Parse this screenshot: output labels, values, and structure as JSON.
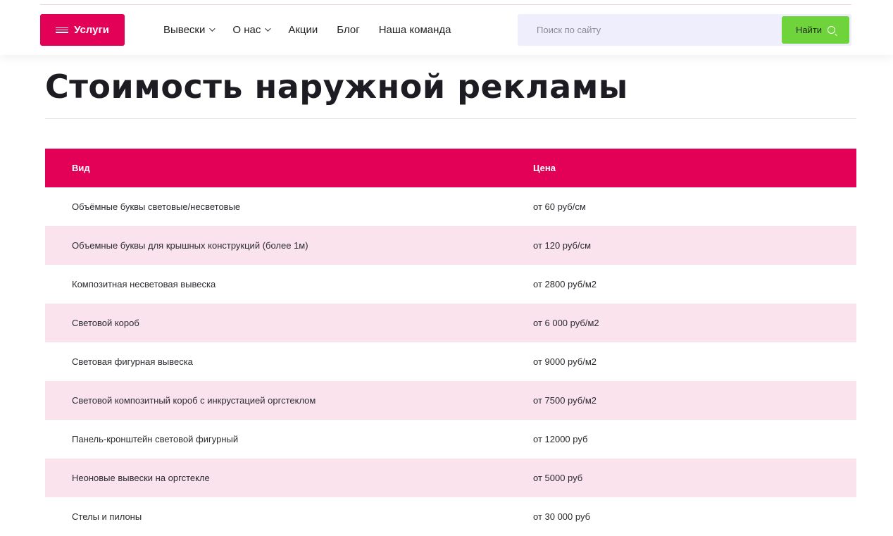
{
  "header": {
    "services_label": "Услуги",
    "nav": [
      {
        "label": "Вывески",
        "has_dropdown": true
      },
      {
        "label": "О нас",
        "has_dropdown": true
      },
      {
        "label": "Акции",
        "has_dropdown": false
      },
      {
        "label": "Блог",
        "has_dropdown": false
      },
      {
        "label": "Наша команда",
        "has_dropdown": false
      }
    ],
    "search": {
      "placeholder": "Поиск по сайту",
      "value": "",
      "button_label": "Найти"
    }
  },
  "page": {
    "title": "Стоимость наружной рекламы"
  },
  "table": {
    "headers": {
      "type": "Вид",
      "price": "Цена"
    },
    "rows": [
      {
        "type": "Объёмные буквы световые/несветовые",
        "price": "от 60 руб/см"
      },
      {
        "type": "Объемные буквы для крышных конструкций (более 1м)",
        "price": "от 120 руб/см"
      },
      {
        "type": "Композитная несветовая вывеска",
        "price": "от 2800 руб/м2"
      },
      {
        "type": "Световой короб",
        "price": "от 6 000 руб/м2"
      },
      {
        "type": "Световая фигурная вывеска",
        "price": "от 9000 руб/м2"
      },
      {
        "type": "Световой композитный короб с инкрустацией оргстеклом",
        "price": "от 7500 руб/м2"
      },
      {
        "type": "Панель-кронштейн световой фигурный",
        "price": "от 12000 руб"
      },
      {
        "type": "Неоновые вывески на оргстекле",
        "price": "от 5000 руб"
      },
      {
        "type": "Стелы и пилоны",
        "price": "от 30 000 руб"
      }
    ]
  },
  "colors": {
    "accent": "#e30057",
    "row_alt": "#fbe3ee",
    "search_bg": "#eeeefd",
    "search_button": "#6fd43b"
  },
  "icons": {
    "services": "menu-icon",
    "dropdown": "chevron-down-icon",
    "search": "search-icon"
  }
}
